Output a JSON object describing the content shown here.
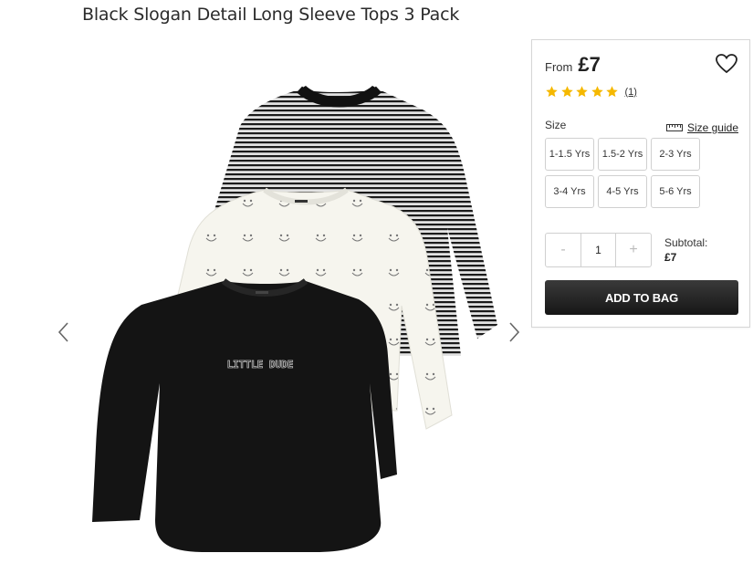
{
  "product": {
    "title": "Black Slogan Detail Long Sleeve Tops 3 Pack"
  },
  "gallery": {
    "image_icon": "product-photo",
    "prev_icon": "chevron-left-icon",
    "next_icon": "chevron-right-icon"
  },
  "panel": {
    "from_label": "From",
    "price": "£7",
    "wishlist_icon": "heart-icon",
    "rating": {
      "stars": 5,
      "max": 5,
      "review_count": "(1)",
      "star_color": "#f5b800"
    },
    "size_label": "Size",
    "size_guide_label": "Size guide",
    "sizes": [
      "1-1.5 Yrs",
      "1.5-2 Yrs",
      "2-3 Yrs",
      "3-4 Yrs",
      "4-5 Yrs",
      "5-6 Yrs"
    ],
    "quantity": {
      "minus": "-",
      "value": "1",
      "plus": "+"
    },
    "subtotal_label": "Subtotal:",
    "subtotal_value": "£7",
    "add_to_bag_label": "ADD TO BAG",
    "button_color": "#1e1e1e"
  },
  "shirt_print": "LITTLE DUDE"
}
